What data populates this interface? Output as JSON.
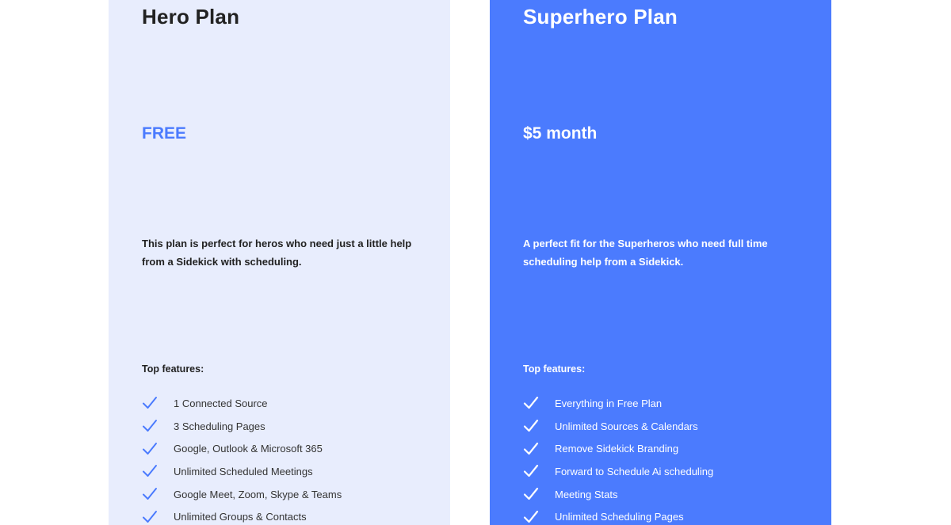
{
  "colors": {
    "accent": "#4b7bfe",
    "hero_bg": "#e8edfd",
    "superhero_bg": "#4b7bfe",
    "text_dark": "#222222",
    "text_light": "#ffffff"
  },
  "plans": [
    {
      "title": "Hero Plan",
      "price": "FREE",
      "description": "This plan is perfect for heros who need just a little help from a Sidekick with scheduling.",
      "features_heading": "Top features:",
      "check_icon": "checkmark-icon",
      "features": [
        "1 Connected Source",
        "3 Scheduling Pages",
        "Google, Outlook & Microsoft 365",
        "Unlimited Scheduled Meetings",
        "Google Meet, Zoom, Skype & Teams",
        "Unlimited Groups & Contacts"
      ]
    },
    {
      "title": "Superhero Plan",
      "price": "$5 month",
      "description": "A perfect fit for the Superheros who need full time scheduling help from a Sidekick.",
      "features_heading": "Top features:",
      "check_icon": "checkmark-icon",
      "features": [
        "Everything in Free Plan",
        "Unlimited Sources & Calendars",
        "Remove Sidekick Branding",
        "Forward to Schedule Ai scheduling",
        "Meeting Stats",
        "Unlimited Scheduling Pages"
      ]
    }
  ]
}
